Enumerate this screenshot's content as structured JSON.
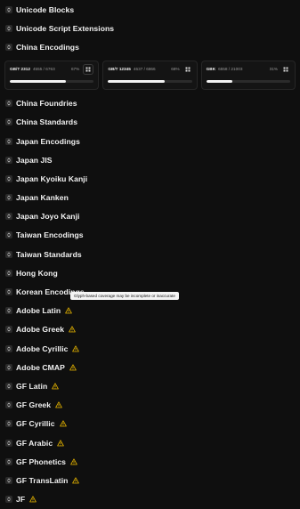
{
  "groups": [
    {
      "label": "Unicode Blocks"
    },
    {
      "label": "Unicode Script Extensions"
    },
    {
      "label": "China Encodings"
    }
  ],
  "cards": [
    {
      "name": "GB/T 2312",
      "count": "4555 / 6763",
      "pct": "67%",
      "progress": 0.67
    },
    {
      "name": "GB/T 12345",
      "count": "4637 / 6866",
      "pct": "68%",
      "progress": 0.68
    },
    {
      "name": "GBK",
      "count": "6558 / 21003",
      "pct": "31%",
      "progress": 0.31
    }
  ],
  "groups_after": [
    {
      "label": "China Foundries",
      "warn": false
    },
    {
      "label": "China Standards",
      "warn": false
    },
    {
      "label": "Japan Encodings",
      "warn": false
    },
    {
      "label": "Japan JIS",
      "warn": false
    },
    {
      "label": "Japan Kyoiku Kanji",
      "warn": false
    },
    {
      "label": "Japan Kanken",
      "warn": false
    },
    {
      "label": "Japan Joyo Kanji",
      "warn": false
    },
    {
      "label": "Taiwan Encodings",
      "warn": false
    },
    {
      "label": "Taiwan Standards",
      "warn": false
    },
    {
      "label": "Hong Kong",
      "warn": false
    },
    {
      "label": "Korean Encodings",
      "warn": false
    },
    {
      "label": "Adobe Latin",
      "warn": true
    },
    {
      "label": "Adobe Greek",
      "warn": true
    },
    {
      "label": "Adobe Cyrillic",
      "warn": true
    },
    {
      "label": "Adobe CMAP",
      "warn": true
    },
    {
      "label": "GF Latin",
      "warn": true
    },
    {
      "label": "GF Greek",
      "warn": true
    },
    {
      "label": "GF Cyrillic",
      "warn": true
    },
    {
      "label": "GF Arabic",
      "warn": true
    },
    {
      "label": "GF Phonetics",
      "warn": true
    },
    {
      "label": "GF TransLatin",
      "warn": true
    },
    {
      "label": "JF",
      "warn": true
    }
  ],
  "tooltip": "Glyph-based coverage may be incomplete or inaccurate",
  "colors": {
    "warn": "#e0b000",
    "bg": "#0f0f0f"
  }
}
